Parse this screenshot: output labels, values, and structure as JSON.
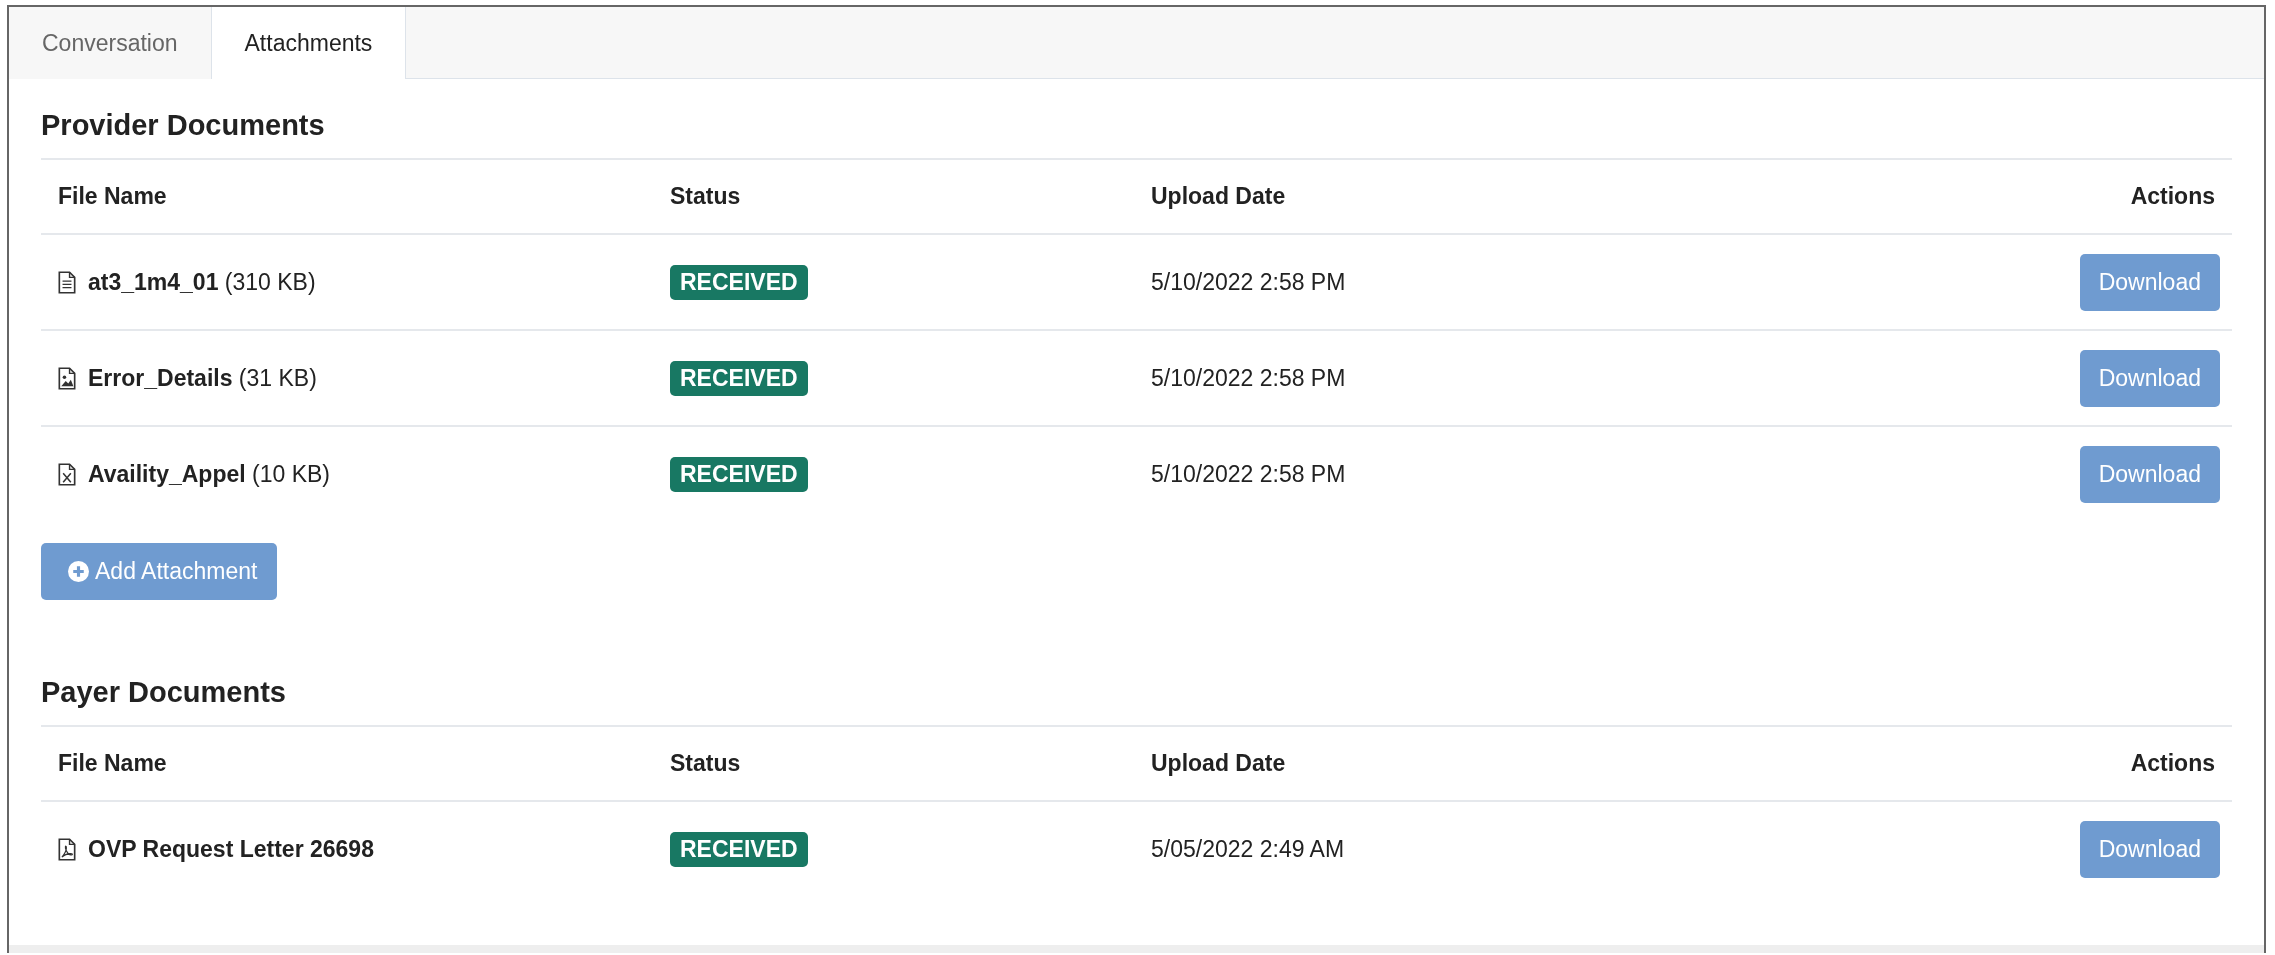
{
  "tabs": [
    {
      "label": "Conversation",
      "selected": false
    },
    {
      "label": "Attachments",
      "selected": true
    }
  ],
  "sections": [
    {
      "title": "Provider Documents",
      "columns": [
        "File Name",
        "Status",
        "Upload Date",
        "Actions"
      ],
      "rows": [
        {
          "kind": "text",
          "name": "at3_1m4_01",
          "size": "(310 KB)",
          "status": "RECEIVED",
          "date": "5/10/2022 2:58 PM",
          "action": "Download"
        },
        {
          "kind": "image",
          "name": "Error_Details",
          "size": "(31 KB)",
          "status": "RECEIVED",
          "date": "5/10/2022 2:58 PM",
          "action": "Download"
        },
        {
          "kind": "spreadsheet",
          "name": "Availity_Appel",
          "size": "(10 KB)",
          "status": "RECEIVED",
          "date": "5/10/2022 2:58 PM",
          "action": "Download"
        }
      ],
      "add_button": "Add Attachment"
    },
    {
      "title": "Payer Documents",
      "columns": [
        "File Name",
        "Status",
        "Upload Date",
        "Actions"
      ],
      "rows": [
        {
          "kind": "pdf",
          "name": "OVP Request Letter 26698",
          "status": "RECEIVED",
          "date": "5/05/2022 2:49 AM",
          "action": "Download"
        }
      ]
    }
  ]
}
